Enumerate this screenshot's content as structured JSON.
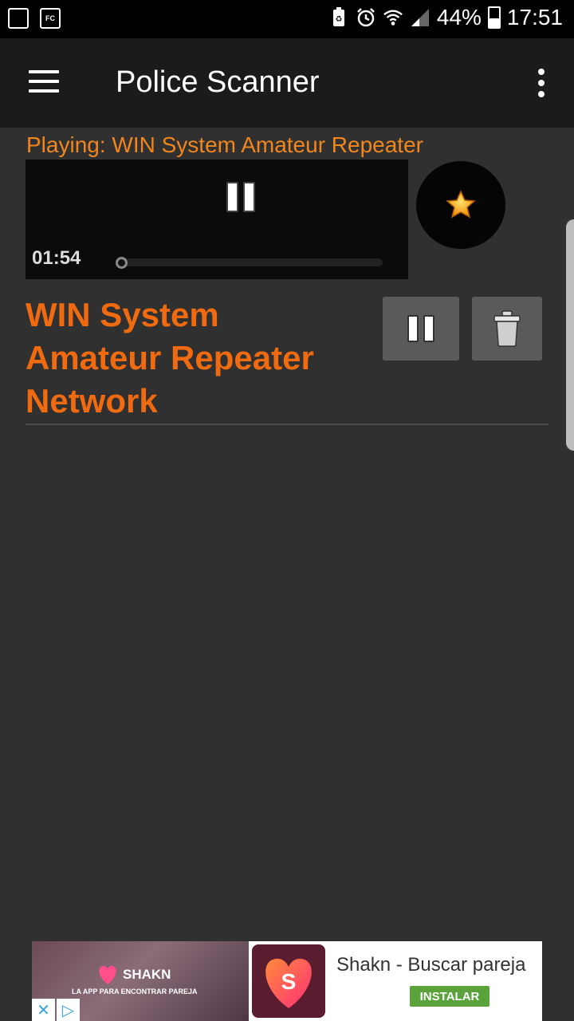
{
  "status_bar": {
    "left_icons": [
      "screen-cast-icon",
      "fc-app-icon"
    ],
    "left_labels": [
      "",
      "FC"
    ],
    "battery_percent": "44%",
    "time": "17:51"
  },
  "app_bar": {
    "title": "Police Scanner"
  },
  "now_playing": {
    "prefix": "Playing:",
    "title": "WIN System Amateur Repeater",
    "elapsed": "01:54",
    "progress": 0.0
  },
  "station": {
    "name": "WIN System Amateur Repeater Network"
  },
  "ad": {
    "brand": "SHAKN",
    "tagline": "LA APP PARA ENCONTRAR PAREJA",
    "app_name": "Shakn - Buscar pareja",
    "install_label": "INSTALAR",
    "icon_letter": "S"
  },
  "colors": {
    "accent_orange": "#f06a10",
    "playing_orange": "#f0861d",
    "background": "#303030",
    "install_green": "#5aa33a"
  }
}
